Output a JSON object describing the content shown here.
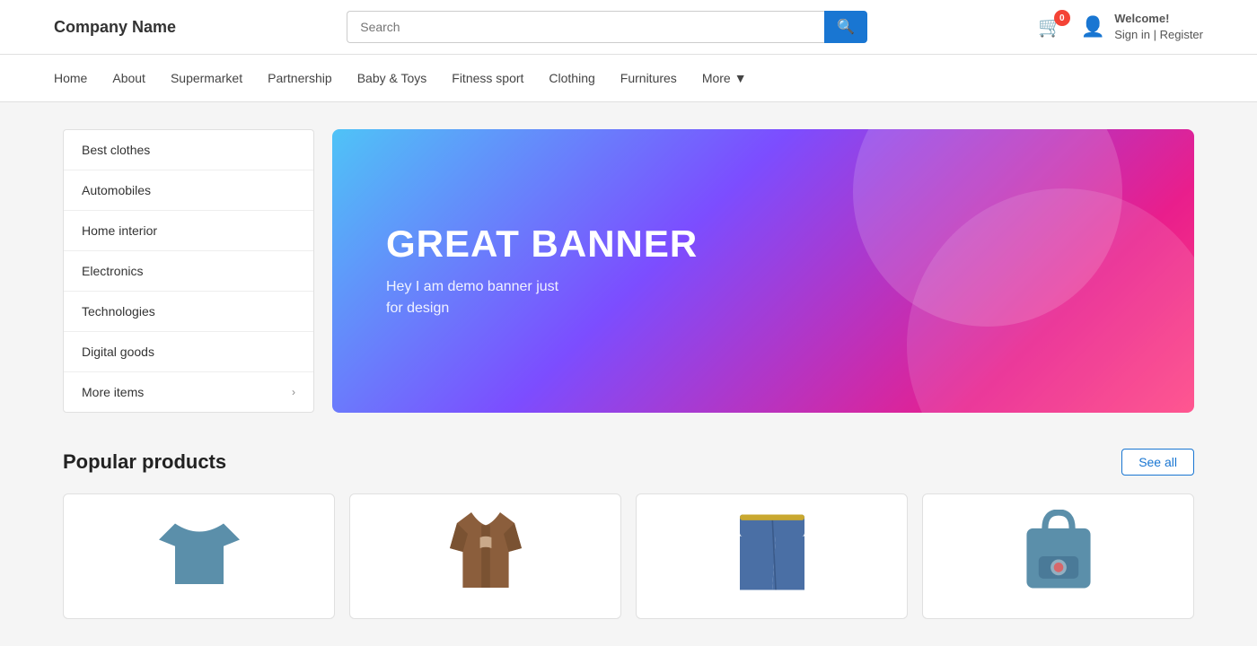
{
  "header": {
    "logo": "Company Name",
    "search_placeholder": "Search",
    "cart_badge": "0",
    "welcome_text": "Welcome!",
    "signin_text": "Sign in | Register"
  },
  "navbar": {
    "items": [
      {
        "label": "Home",
        "id": "home"
      },
      {
        "label": "About",
        "id": "about"
      },
      {
        "label": "Supermarket",
        "id": "supermarket"
      },
      {
        "label": "Partnership",
        "id": "partnership"
      },
      {
        "label": "Baby &amp; Toys",
        "id": "baby-toys"
      },
      {
        "label": "Fitness sport",
        "id": "fitness-sport"
      },
      {
        "label": "Clothing",
        "id": "clothing"
      },
      {
        "label": "Furnitures",
        "id": "furnitures"
      },
      {
        "label": "More",
        "id": "more"
      }
    ]
  },
  "sidebar": {
    "items": [
      {
        "label": "Best clothes",
        "id": "best-clothes",
        "has_arrow": false
      },
      {
        "label": "Automobiles",
        "id": "automobiles",
        "has_arrow": false
      },
      {
        "label": "Home interior",
        "id": "home-interior",
        "has_arrow": false
      },
      {
        "label": "Electronics",
        "id": "electronics",
        "has_arrow": false
      },
      {
        "label": "Technologies",
        "id": "technologies",
        "has_arrow": false
      },
      {
        "label": "Digital goods",
        "id": "digital-goods",
        "has_arrow": false
      },
      {
        "label": "More items",
        "id": "more-items",
        "has_arrow": true
      }
    ]
  },
  "banner": {
    "title": "GREAT BANNER",
    "subtitle": "Hey I am demo banner just\nfor design"
  },
  "popular": {
    "title": "Popular products",
    "see_all_label": "See all"
  },
  "products": [
    {
      "id": "tshirt",
      "color": "#5b8faa",
      "type": "tshirt"
    },
    {
      "id": "jacket",
      "color": "#8B5E3C",
      "type": "jacket"
    },
    {
      "id": "jeans",
      "color": "#4a6fa5",
      "type": "jeans"
    },
    {
      "id": "bag",
      "color": "#5b8faa",
      "type": "bag"
    }
  ],
  "colors": {
    "primary": "#1976d2",
    "cart_badge": "#f44336"
  }
}
